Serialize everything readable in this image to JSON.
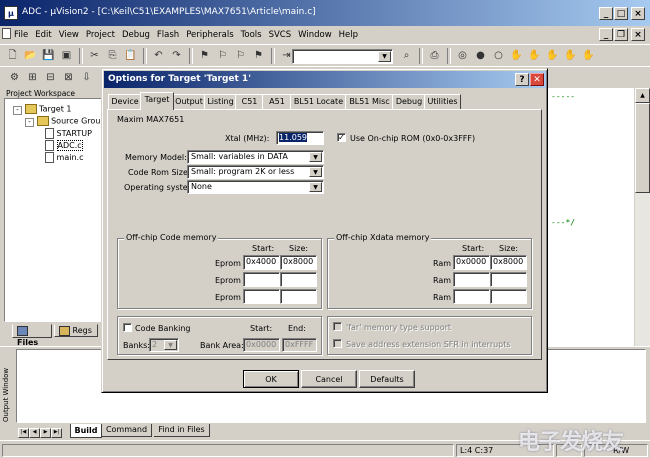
{
  "app": {
    "title": "ADC - µVision2 - [C:\\Keil\\C51\\EXAMPLES\\MAX7651\\Article\\main.c]",
    "title_color_start": "#0a246a",
    "title_color_end": "#a6caf0"
  },
  "menu": [
    "File",
    "Edit",
    "View",
    "Project",
    "Debug",
    "Flash",
    "Peripherals",
    "Tools",
    "SVCS",
    "Window",
    "Help"
  ],
  "workspace": {
    "title": "Project Workspace",
    "tree": {
      "target": "Target 1",
      "group": "Source Group",
      "files": [
        "STARTUP",
        "ADC.c",
        "main.c"
      ]
    },
    "tabs": [
      "Files",
      "Regs"
    ]
  },
  "editor": {
    "dashes_top": "-----",
    "dashes_mid": "---*/"
  },
  "output": {
    "title": "Output Window",
    "tabs": [
      "Build",
      "Command",
      "Find in Files"
    ]
  },
  "statusbar": {
    "position": "L:4 C:37",
    "mode": "R/W"
  },
  "dialog": {
    "title": "Options for Target 'Target 1'",
    "help_icon": "?",
    "tabs": [
      "Device",
      "Target",
      "Output",
      "Listing",
      "C51",
      "A51",
      "BL51 Locate",
      "BL51 Misc",
      "Debug",
      "Utilities"
    ],
    "active_tab": "Target",
    "device_name": "Maxim MAX7651",
    "xtal_label": "Xtal (MHz):",
    "xtal_value": "11.059",
    "onchip_rom_label": "Use On-chip ROM (0x0-0x3FFF)",
    "onchip_rom_checked": true,
    "memory_model_label": "Memory Model:",
    "memory_model_value": "Small: variables in DATA",
    "code_rom_label": "Code Rom Size:",
    "code_rom_value": "Small: program 2K or less",
    "os_label": "Operating system:",
    "os_value": "None",
    "offchip_code": {
      "title": "Off-chip Code memory",
      "start_header": "Start:",
      "size_header": "Size:",
      "rows": [
        {
          "label": "Eprom",
          "start": "0x4000",
          "size": "0x8000"
        },
        {
          "label": "Eprom",
          "start": "",
          "size": ""
        },
        {
          "label": "Eprom",
          "start": "",
          "size": ""
        }
      ]
    },
    "offchip_xdata": {
      "title": "Off-chip Xdata memory",
      "start_header": "Start:",
      "size_header": "Size:",
      "rows": [
        {
          "label": "Ram",
          "start": "0x0000",
          "size": "0x8000"
        },
        {
          "label": "Ram",
          "start": "",
          "size": ""
        },
        {
          "label": "Ram",
          "start": "",
          "size": ""
        }
      ]
    },
    "code_banking": {
      "label": "Code Banking",
      "checked": false,
      "start_header": "Start:",
      "end_header": "End:",
      "banks_label": "Banks:",
      "banks_value": "2",
      "bank_area_label": "Bank Area:",
      "bank_start": "0x0000",
      "bank_end": "0xFFFF"
    },
    "far_memory_label": "'far' memory type support",
    "save_sfr_label": "Save address extension SFR in interrupts",
    "ok_label": "OK",
    "cancel_label": "Cancel",
    "defaults_label": "Defaults"
  },
  "watermark": "电子发烧友"
}
